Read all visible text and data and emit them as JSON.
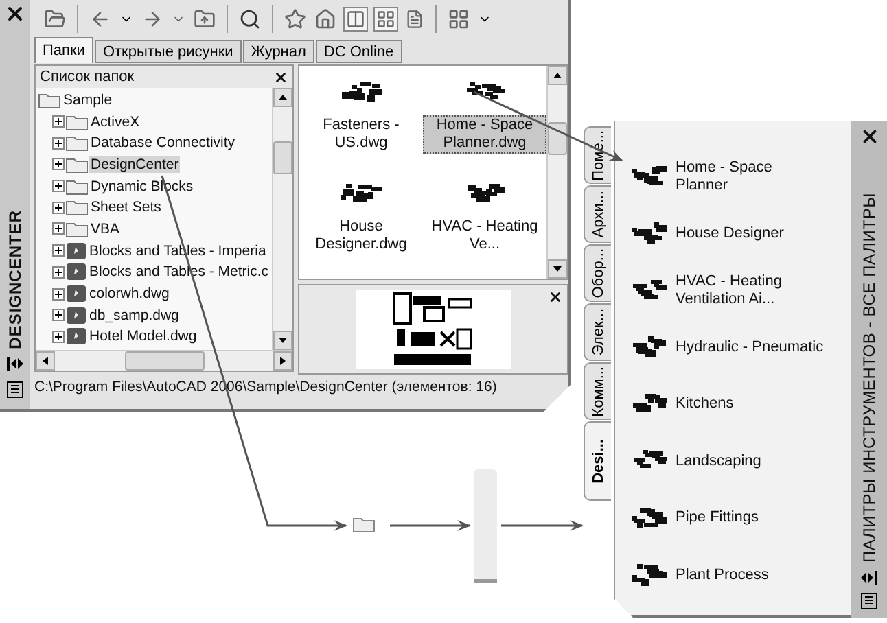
{
  "designcenter": {
    "title": "DESIGNCENTER",
    "tabs": [
      {
        "label": "Папки",
        "selected": true
      },
      {
        "label": "Открытые рисунки",
        "selected": false
      },
      {
        "label": "Журнал",
        "selected": false
      },
      {
        "label": "DC Online",
        "selected": false
      }
    ],
    "folder_list": {
      "title": "Список папок",
      "tree": [
        {
          "label": "Sample",
          "kind": "folder",
          "selected": false,
          "children": [
            {
              "label": "ActiveX",
              "kind": "folder",
              "selected": false,
              "expanded": false
            },
            {
              "label": "Database Connectivity",
              "kind": "folder",
              "selected": false,
              "expanded": false
            },
            {
              "label": "DesignCenter",
              "kind": "folder",
              "selected": true,
              "expanded": false
            },
            {
              "label": "Dynamic Blocks",
              "kind": "folder",
              "selected": false,
              "expanded": false
            },
            {
              "label": "Sheet Sets",
              "kind": "folder",
              "selected": false,
              "expanded": false
            },
            {
              "label": "VBA",
              "kind": "folder",
              "selected": false,
              "expanded": false
            },
            {
              "label": "Blocks and Tables - Imperia",
              "kind": "drawing",
              "selected": false,
              "expanded": false
            },
            {
              "label": "Blocks and Tables - Metric.c",
              "kind": "drawing",
              "selected": false,
              "expanded": false
            },
            {
              "label": "colorwh.dwg",
              "kind": "drawing",
              "selected": false,
              "expanded": false
            },
            {
              "label": "db_samp.dwg",
              "kind": "drawing",
              "selected": false,
              "expanded": false
            },
            {
              "label": "Hotel Model.dwg",
              "kind": "drawing",
              "selected": false,
              "expanded": false
            }
          ]
        }
      ]
    },
    "content": [
      {
        "label": "Fasteners - US.dwg",
        "selected": false
      },
      {
        "label": "Home - Space Planner.dwg",
        "selected": true
      },
      {
        "label": "House Designer.dwg",
        "selected": false
      },
      {
        "label": "HVAC - Heating Ve...",
        "selected": false
      }
    ],
    "status_bar": "C:\\Program Files\\AutoCAD 2006\\Sample\\DesignCenter (элементов: 16)"
  },
  "palette": {
    "title": "ПАЛИТРЫ ИНСТРУМЕНТОВ - ВСЕ ПАЛИТРЫ",
    "tabs": [
      {
        "label": "Поме...",
        "selected": false
      },
      {
        "label": "Архи...",
        "selected": false
      },
      {
        "label": "Обор...",
        "selected": false
      },
      {
        "label": "Элек...",
        "selected": false
      },
      {
        "label": "Комм...",
        "selected": false
      },
      {
        "label": "Desi...",
        "selected": true
      }
    ],
    "items": [
      {
        "label": "Home - Space Planner"
      },
      {
        "label": "House Designer"
      },
      {
        "label": "HVAC - Heating Ventilation Ai..."
      },
      {
        "label": "Hydraulic - Pneumatic"
      },
      {
        "label": "Kitchens"
      },
      {
        "label": "Landscaping"
      },
      {
        "label": "Pipe Fittings"
      },
      {
        "label": "Plant Process"
      }
    ]
  }
}
